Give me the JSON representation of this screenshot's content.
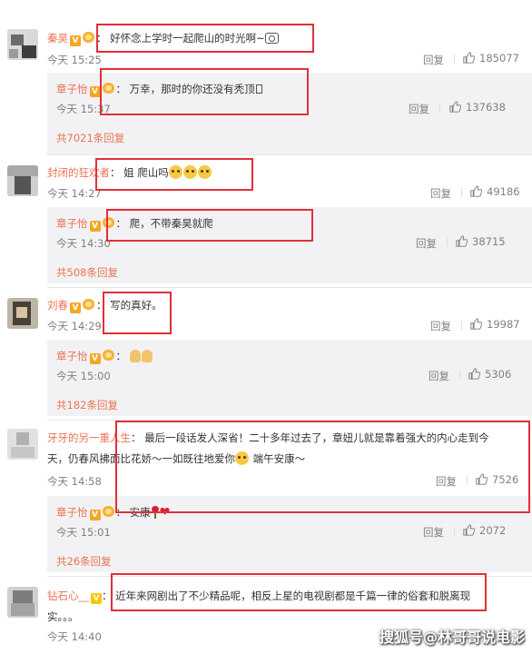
{
  "comments": [
    {
      "user": "秦昊",
      "text": "好怀念上学时一起爬山的时光啊~",
      "time": "今天 15:25",
      "reply": "回复",
      "likes": "185077",
      "sub": {
        "user": "章子怡",
        "text": "万幸，那时的你还没有秃顶",
        "time": "今天 15:37",
        "reply": "回复",
        "likes": "137638"
      },
      "more": "共7021条回复"
    },
    {
      "user": "封闭的狂欢者",
      "text": "姐 爬山吗",
      "time": "今天 14:27",
      "reply": "回复",
      "likes": "49186",
      "sub": {
        "user": "章子怡",
        "text": "爬，不带秦昊就爬",
        "time": "今天 14:30",
        "reply": "回复",
        "likes": "38715"
      },
      "more": "共508条回复"
    },
    {
      "user": "刘春",
      "text": "写的真好。",
      "time": "今天 14:29",
      "reply": "回复",
      "likes": "19987",
      "sub": {
        "user": "章子怡",
        "text": "",
        "time": "今天 15:00",
        "reply": "回复",
        "likes": "5306"
      },
      "more": "共182条回复"
    },
    {
      "user": "牙牙的另一重人生",
      "text_line1": "最后一段话发人深省！二十多年过去了，章妞儿就是靠着强大的内心走到今",
      "text_line2": "天，仍春风拂面比花娇～一如既往地爱你",
      "text_tail": " 端午安康～",
      "time": "今天 14:58",
      "reply": "回复",
      "likes": "7526",
      "sub": {
        "user": "章子怡",
        "text": "安康",
        "time": "今天 15:01",
        "reply": "回复",
        "likes": "2072"
      },
      "more": "共26条回复"
    },
    {
      "user": "钻石心__",
      "text_line1": "近年来网剧出了不少精品呢，相反上星的电视剧都是千篇一律的俗套和脱离现",
      "text_line2": "实。。。",
      "time": "今天 14:40"
    }
  ],
  "watermark": "搜狐号@林哥哥说电影",
  "colors": {
    "username": "#eb7350",
    "highlight_box": "#e0303a",
    "subbox_bg": "#f2f2f5"
  },
  "icons": [
    "like-thumb-icon",
    "verified-v-icon",
    "level-badge-icon",
    "camera-emoji-icon",
    "cat-emoji-icon",
    "pray-emoji-icon",
    "rose-emoji-icon",
    "heart-emoji-icon",
    "sad-emoji-icon"
  ]
}
